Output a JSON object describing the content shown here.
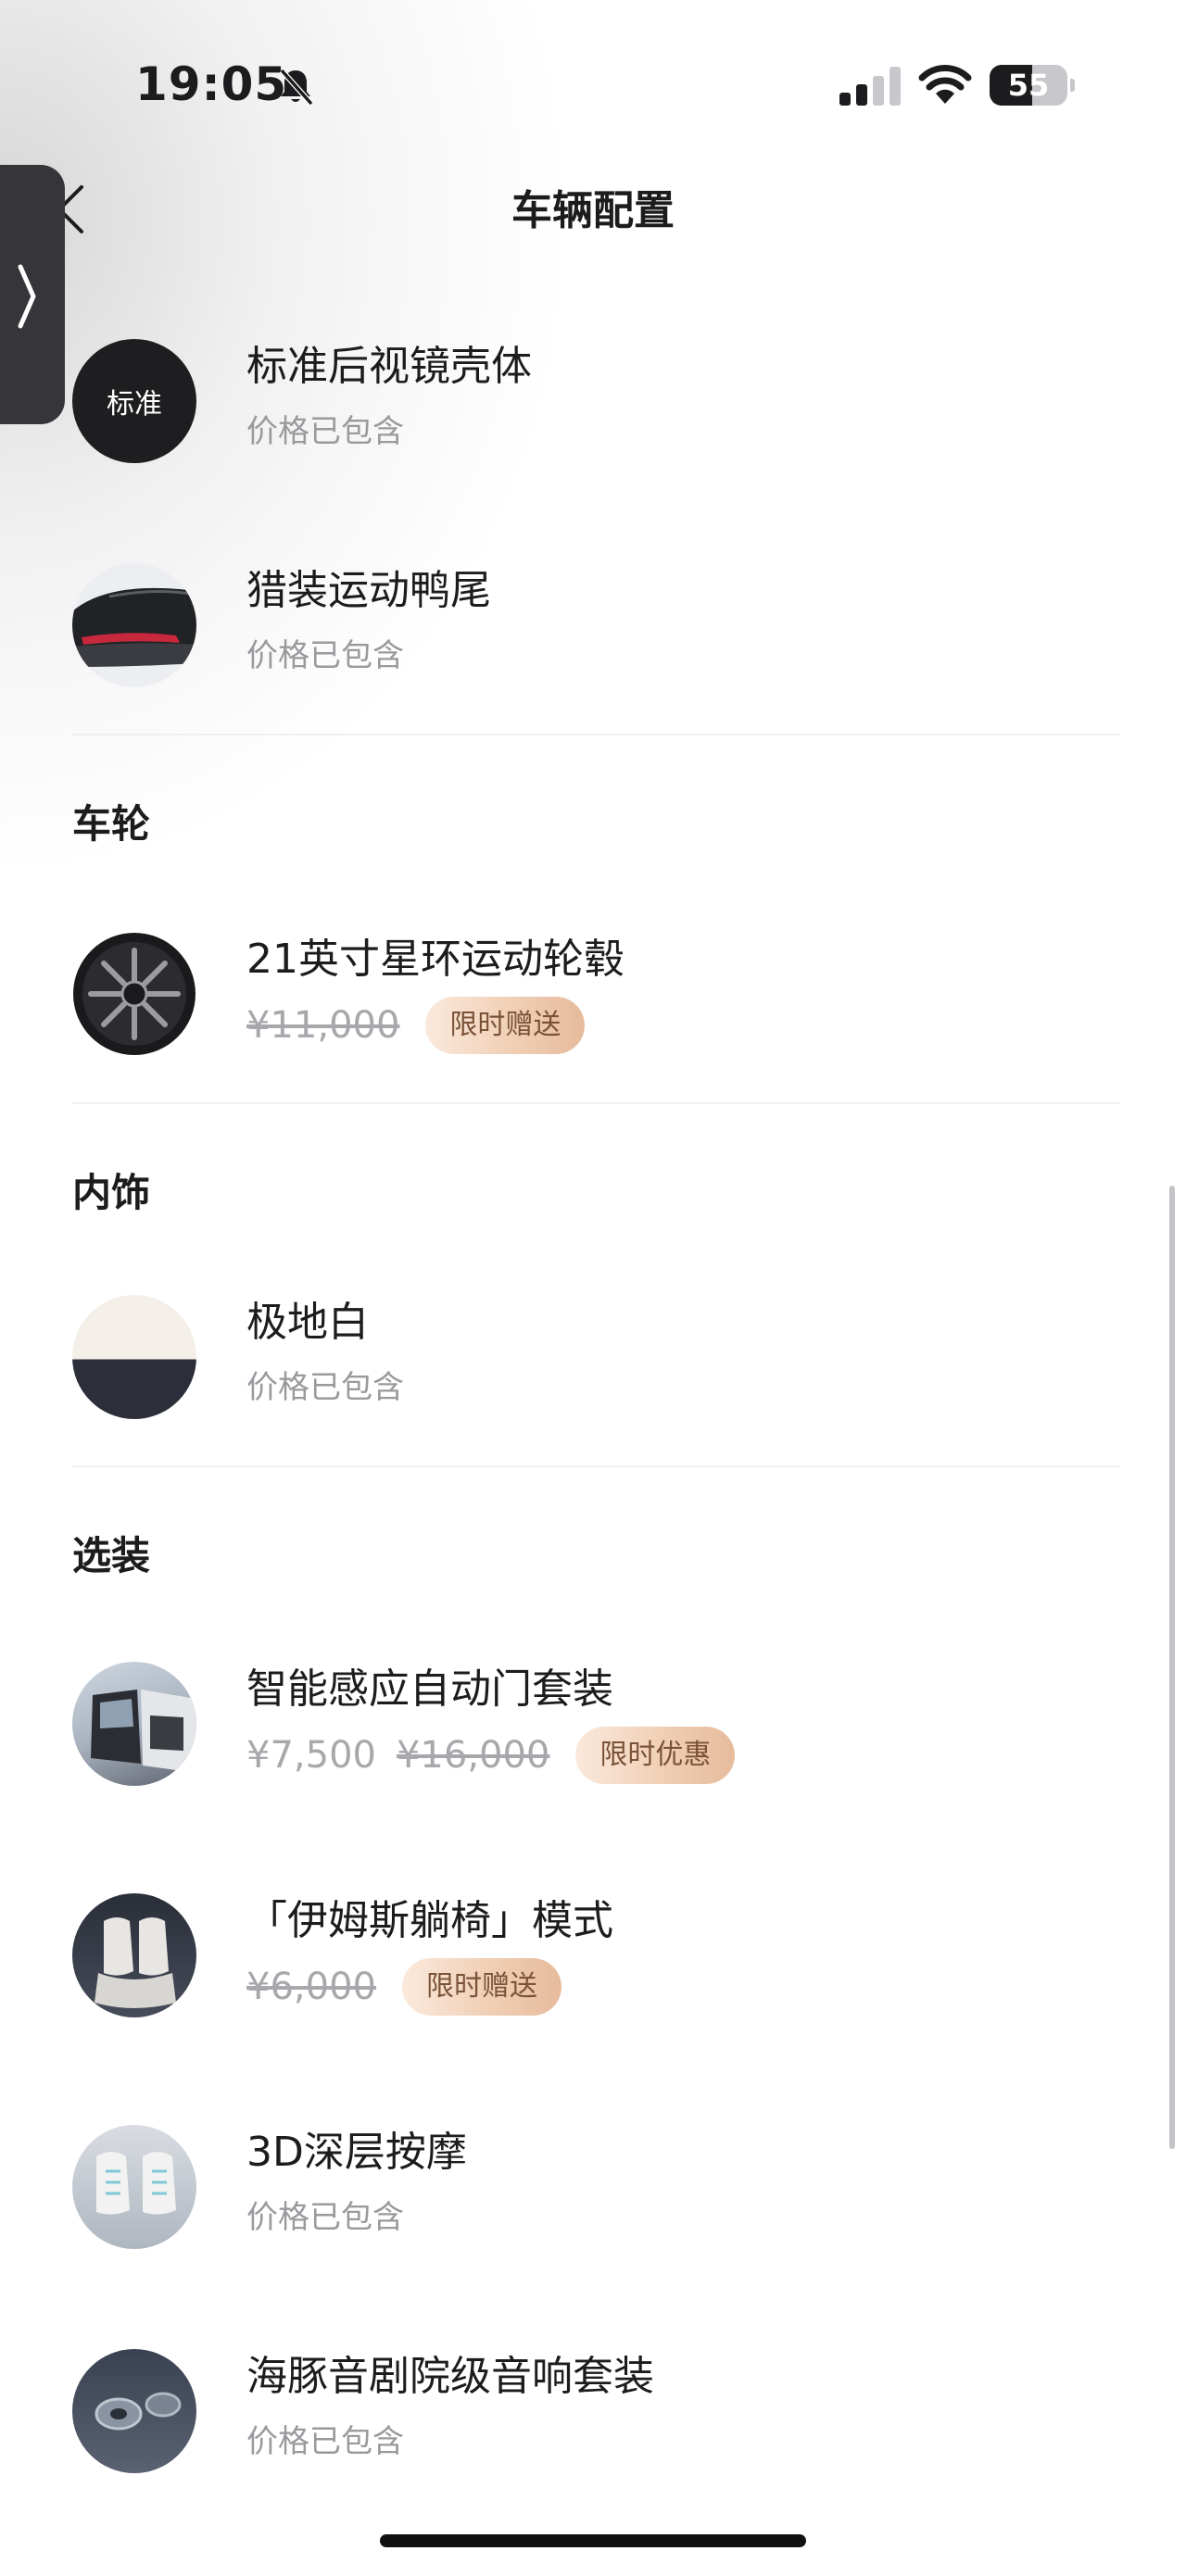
{
  "status_bar": {
    "time": "19:05",
    "battery": "55",
    "battery_level": 0.55
  },
  "nav": {
    "title": "车辆配置"
  },
  "top_items": [
    {
      "name": "标准后视镜壳体",
      "thumb_text": "标准",
      "sub": "价格已包含"
    },
    {
      "name": "猎装运动鸭尾",
      "sub": "价格已包含"
    }
  ],
  "wheels": {
    "section": "车轮",
    "item": {
      "name": "21英寸星环运动轮毂",
      "original_price": "¥11,000",
      "badge": "限时赠送"
    }
  },
  "interior": {
    "section": "内饰",
    "item": {
      "name": "极地白",
      "sub": "价格已包含"
    }
  },
  "options": {
    "section": "选装",
    "items": [
      {
        "name": "智能感应自动门套装",
        "price": "¥7,500",
        "original_price": "¥16,000",
        "badge": "限时优惠"
      },
      {
        "name": "「伊姆斯躺椅」模式",
        "original_price": "¥6,000",
        "badge": "限时赠送"
      },
      {
        "name": "3D深层按摩",
        "sub": "价格已包含"
      },
      {
        "name": "海豚音剧院级音响套装",
        "sub": "价格已包含"
      }
    ]
  },
  "colors": {
    "accent_badge_text": "#7a5238",
    "muted": "#9a9a9e"
  }
}
